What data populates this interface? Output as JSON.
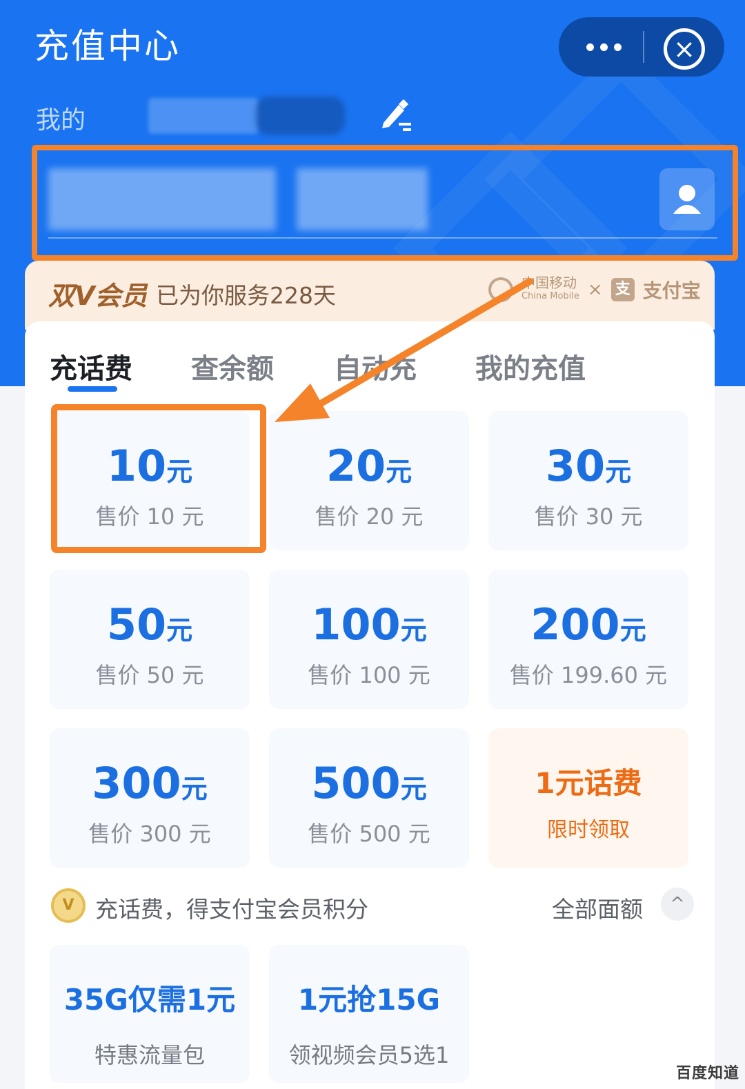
{
  "header": {
    "title": "充值中心",
    "my_label": "我的",
    "more_icon": "more-dots-icon",
    "close_icon": "close-circle-icon"
  },
  "phone": {
    "contact_icon": "contact-person-icon"
  },
  "vip": {
    "title": "双V会员",
    "days_text": "已为你服务228天",
    "logo_text": "中国移动",
    "logo_sub": "China Mobile",
    "times": "×",
    "alipay": "支付宝",
    "alipay_mark": "支"
  },
  "tabs": [
    {
      "label": "充话费",
      "active": true
    },
    {
      "label": "查余额",
      "active": false
    },
    {
      "label": "自动充",
      "active": false
    },
    {
      "label": "我的充值",
      "active": false
    }
  ],
  "amount_unit": "元",
  "amounts": [
    {
      "value": "10",
      "price": "售价 10 元"
    },
    {
      "value": "20",
      "price": "售价 20 元"
    },
    {
      "value": "30",
      "price": "售价 30 元"
    },
    {
      "value": "50",
      "price": "售价 50 元"
    },
    {
      "value": "100",
      "price": "售价 100 元"
    },
    {
      "value": "200",
      "price": "售价 199.60 元"
    },
    {
      "value": "300",
      "price": "售价 300 元"
    },
    {
      "value": "500",
      "price": "售价 500 元"
    }
  ],
  "promo": {
    "title": "1元话费",
    "subtitle": "限时领取"
  },
  "points": {
    "text": "充话费，得支付宝会员积分",
    "all_label": "全部面额",
    "icon": "gold-points-icon",
    "chevron": "^"
  },
  "packages": [
    {
      "title": "35G仅需1元",
      "subtitle": "特惠流量包"
    },
    {
      "title": "1元抢15G",
      "subtitle": "领视频会员5选1"
    }
  ],
  "watermark": "百度知道",
  "colors": {
    "primary": "#1a73f0",
    "highlight": "#f5832a",
    "promo": "#ec6b14"
  }
}
